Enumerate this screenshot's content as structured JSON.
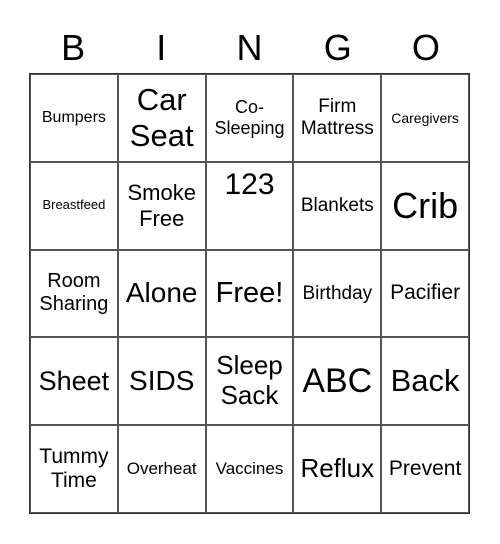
{
  "header": [
    "B",
    "I",
    "N",
    "G",
    "O"
  ],
  "cells": [
    {
      "text": "Bumpers",
      "size": 16
    },
    {
      "text": "Car Seat",
      "size": 31
    },
    {
      "text": "Co-Sleeping",
      "size": 18
    },
    {
      "text": "Firm Mattress",
      "size": 19
    },
    {
      "text": "Caregivers",
      "size": 14
    },
    {
      "text": "Breastfeed",
      "size": 13
    },
    {
      "text": "Smoke Free",
      "size": 22
    },
    {
      "text": "123",
      "size": 30
    },
    {
      "text": "Blankets",
      "size": 19
    },
    {
      "text": "Crib",
      "size": 36
    },
    {
      "text": "Room Sharing",
      "size": 20
    },
    {
      "text": "Alone",
      "size": 28
    },
    {
      "text": "Free!",
      "size": 29
    },
    {
      "text": "Birthday",
      "size": 19
    },
    {
      "text": "Pacifier",
      "size": 21
    },
    {
      "text": "Sheet",
      "size": 27
    },
    {
      "text": "SIDS",
      "size": 28
    },
    {
      "text": "Sleep Sack",
      "size": 26
    },
    {
      "text": "ABC",
      "size": 34
    },
    {
      "text": "Back",
      "size": 31
    },
    {
      "text": "Tummy Time",
      "size": 21
    },
    {
      "text": "Overheat",
      "size": 17
    },
    {
      "text": "Vaccines",
      "size": 17
    },
    {
      "text": "Reflux",
      "size": 26
    },
    {
      "text": "Prevent",
      "size": 21
    }
  ]
}
